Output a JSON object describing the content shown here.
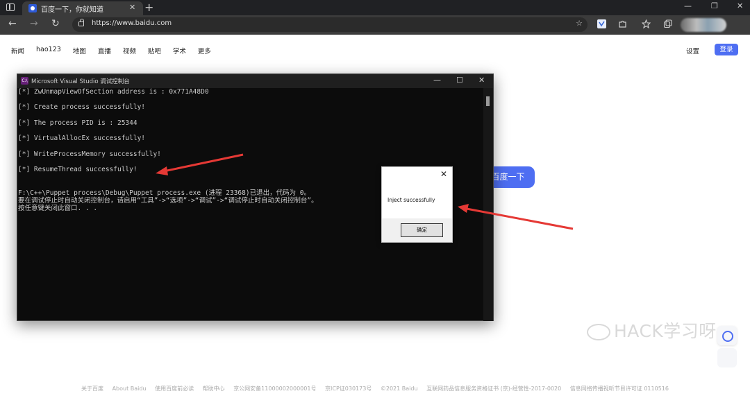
{
  "browser": {
    "tab_title": "百度一下，你就知道",
    "tab_close": "✕",
    "new_tab": "+",
    "url": "https://www.baidu.com",
    "window_controls": [
      "—",
      "❐",
      "✕"
    ]
  },
  "baidu": {
    "nav_links": [
      "新闻",
      "hao123",
      "地图",
      "直播",
      "视频",
      "贴吧",
      "学术",
      "更多"
    ],
    "settings": "设置",
    "login": "登录",
    "search_button": "百度一下",
    "footer": [
      "关于百度",
      "About Baidu",
      "使用百度前必读",
      "帮助中心",
      "京公网安备11000002000001号",
      "京ICP证030173号",
      "©2021 Baidu",
      "互联网药品信息服务资格证书 (京)-经营性-2017-0020",
      "信息网络传播视听节目许可证 0110516"
    ]
  },
  "console": {
    "title": "Microsoft Visual Studio 调试控制台",
    "icon_label": "C:\\",
    "lines": [
      "[*] ZwUnmapViewOfSection address is : 0x771A48D0",
      "",
      "[*] Create process successfully!",
      "",
      "[*] The process PID is : 25344",
      "",
      "[*] VirtualAllocEx successfully!",
      "",
      "[*] WriteProcessMemory successfully!",
      "",
      "[*] ResumeThread successfully!",
      "",
      "",
      "F:\\C++\\Puppet process\\Debug\\Puppet process.exe (进程 23368)已退出，代码为 0。",
      "要在调试停止时自动关闭控制台，请启用“工具”->“选项”->“调试”->“调试停止时自动关闭控制台”。",
      "按任意键关闭此窗口. . ."
    ]
  },
  "msgbox": {
    "message": "Inject successfully",
    "ok": "确定",
    "close": "✕"
  },
  "watermark": {
    "text": "HACK学习呀"
  },
  "colors": {
    "baidu_blue": "#4e6ef2",
    "arrow_red": "#e53935",
    "console_bg": "#0c0c0c"
  }
}
